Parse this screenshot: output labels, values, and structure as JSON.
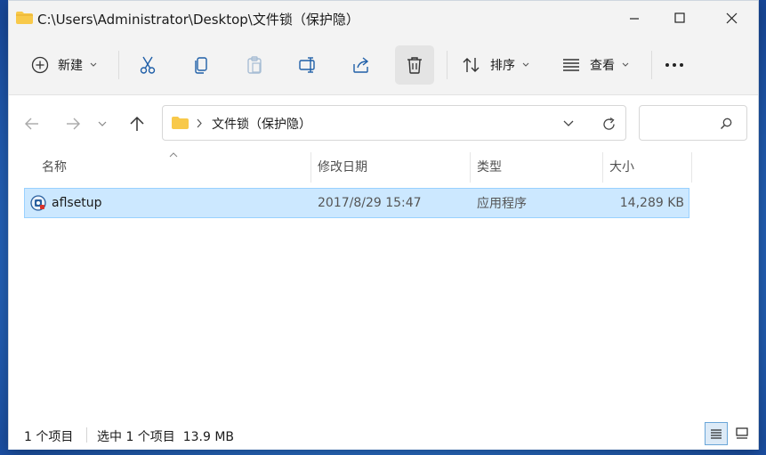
{
  "window": {
    "title": "C:\\Users\\Administrator\\Desktop\\文件锁（保护隐）"
  },
  "toolbar": {
    "new_label": "新建",
    "sort_label": "排序",
    "view_label": "查看"
  },
  "address": {
    "breadcrumb": "文件锁（保护隐）"
  },
  "columns": {
    "name": "名称",
    "modified": "修改日期",
    "type": "类型",
    "size": "大小"
  },
  "files": [
    {
      "name": "aflsetup",
      "modified": "2017/8/29 15:47",
      "type": "应用程序",
      "size": "14,289 KB"
    }
  ],
  "status": {
    "item_count": "1 个项目",
    "selection": "选中 1 个项目  13.9 MB"
  },
  "colors": {
    "accent": "#0067c0",
    "selection_bg": "#cce8ff",
    "selection_border": "#99d1ff",
    "folder": "#f8c94a"
  },
  "icons": [
    "folder-icon",
    "minimize-icon",
    "maximize-icon",
    "close-icon",
    "new-plus-icon",
    "cut-icon",
    "copy-icon",
    "paste-icon",
    "rename-icon",
    "share-icon",
    "delete-icon",
    "sort-icon",
    "view-icon",
    "more-icon",
    "back-icon",
    "forward-icon",
    "recent-icon",
    "up-icon",
    "chevron-right-icon",
    "dropdown-icon",
    "refresh-icon",
    "search-icon",
    "sort-up-icon",
    "app-icon",
    "details-view-icon",
    "large-icons-view-icon"
  ]
}
